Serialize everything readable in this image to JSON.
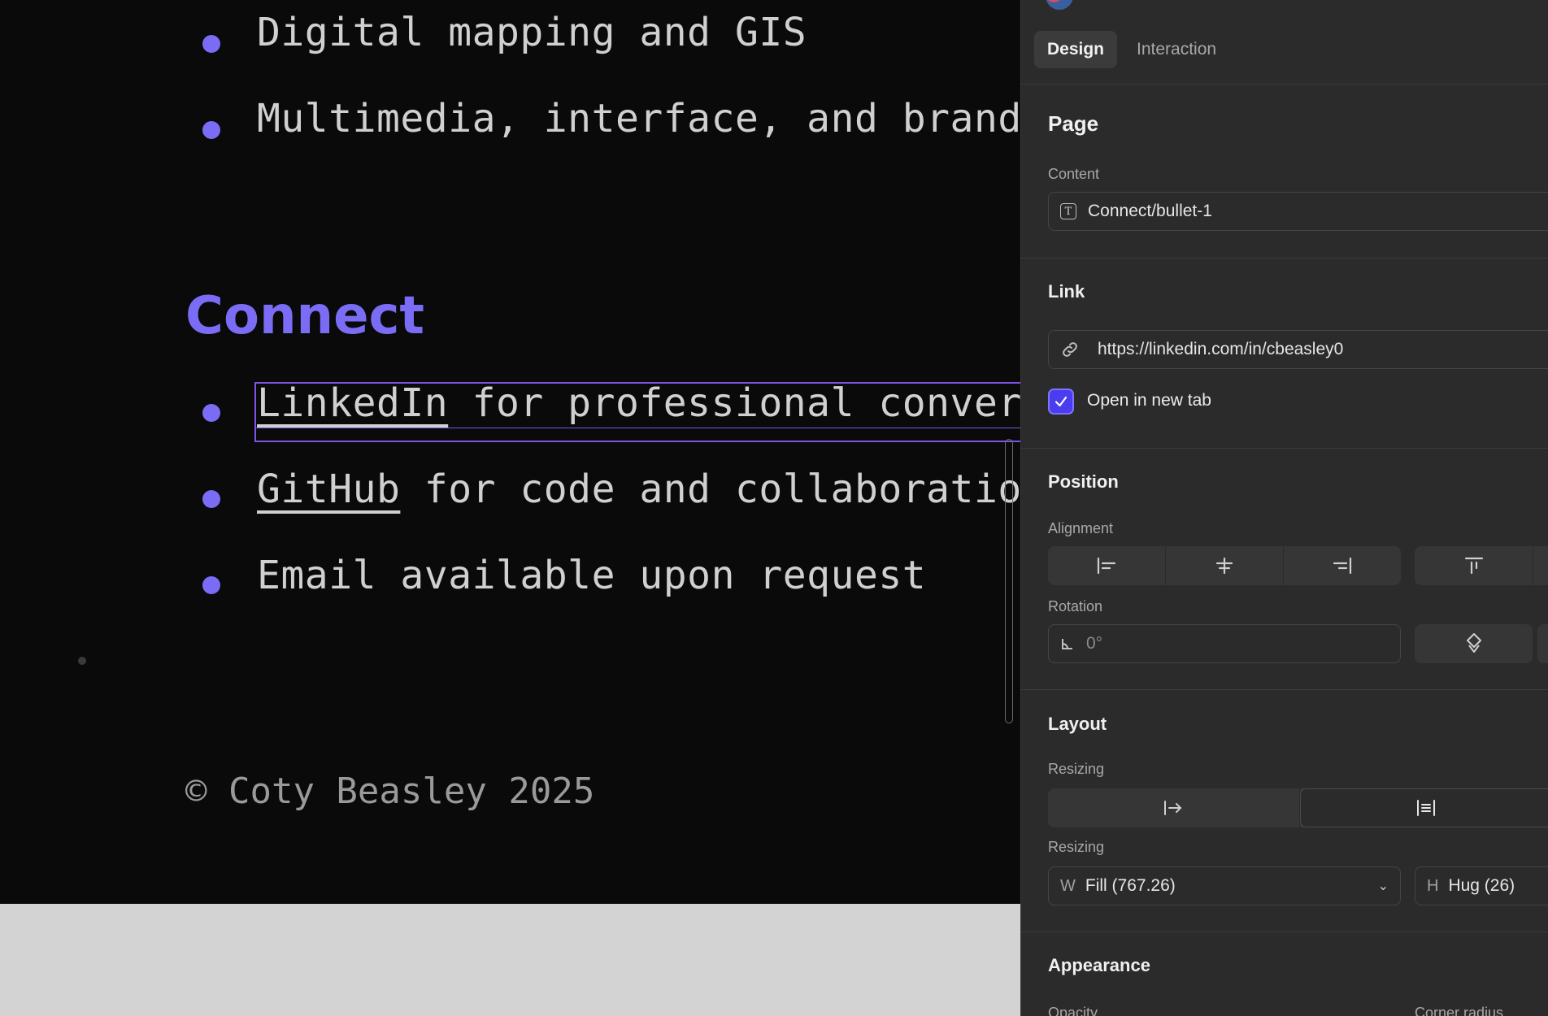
{
  "canvas": {
    "bullets_top": [
      {
        "text": "Digital mapping and GIS"
      },
      {
        "text": "Multimedia, interface, and branding"
      }
    ],
    "heading": "Connect",
    "connect_bullets": [
      {
        "link": "LinkedIn",
        "rest": " for professional conversations"
      },
      {
        "link": "GitHub",
        "rest": " for code and collaboration"
      },
      {
        "link": "",
        "rest": "Email available upon request"
      }
    ],
    "footer": "© Coty Beasley 2025",
    "accent_color": "#7b6cf6"
  },
  "panel": {
    "tabs": [
      {
        "label": "Design",
        "active": true
      },
      {
        "label": "Interaction",
        "active": false
      }
    ],
    "page_section": {
      "title": "Page",
      "content_label": "Content",
      "content_value": "Connect/bullet-1",
      "content_icon": "T"
    },
    "link_section": {
      "title": "Link",
      "url": "https://linkedin.com/in/cbeasley0",
      "open_new_tab_label": "Open in new tab",
      "open_new_tab_checked": true
    },
    "position_section": {
      "title": "Position",
      "alignment_label": "Alignment",
      "rotation_label": "Rotation",
      "rotation_value": "0°"
    },
    "layout_section": {
      "title": "Layout",
      "resizing_label_1": "Resizing",
      "resizing_label_2": "Resizing",
      "width_prefix": "W",
      "width_value": "Fill (767.26)",
      "height_prefix": "H",
      "height_value": "Hug (26)"
    },
    "appearance_section": {
      "title": "Appearance",
      "opacity_label": "Opacity",
      "corner_radius_label": "Corner radius"
    }
  }
}
